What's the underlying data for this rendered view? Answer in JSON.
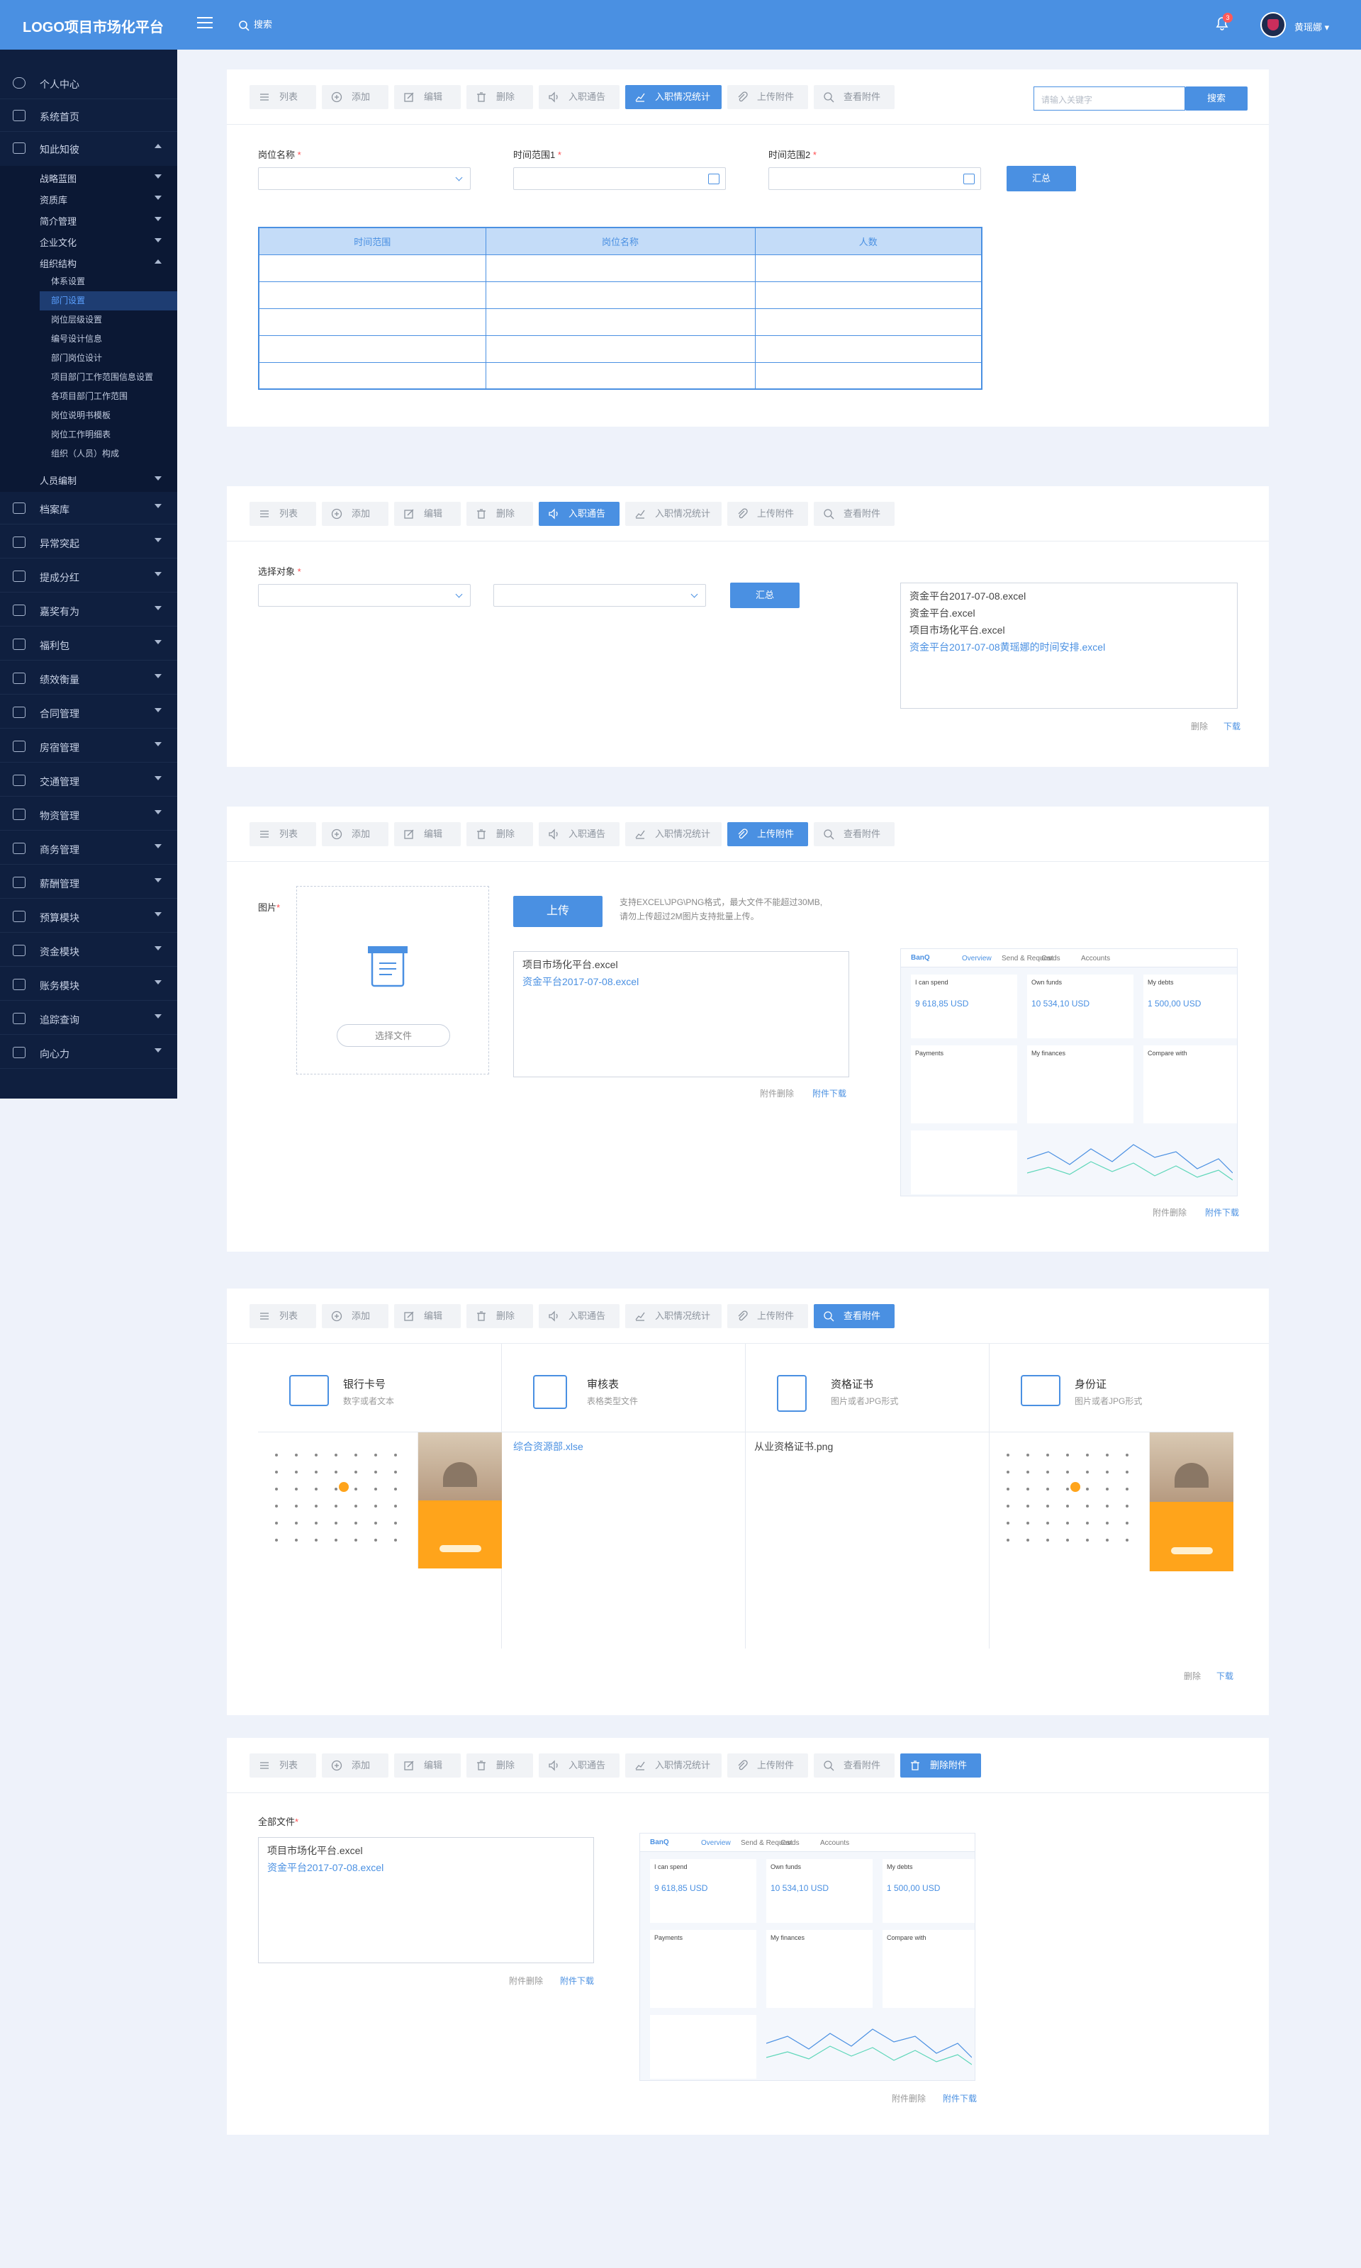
{
  "header": {
    "logo": "LOGO项目市场化平台",
    "search_label": "搜索",
    "notif_count": "3",
    "user_name": "黄瑶娜"
  },
  "sidebar": {
    "top_items": [
      {
        "label": "个人中心"
      },
      {
        "label": "系统首页"
      },
      {
        "label": "知此知彼"
      }
    ],
    "kb_sub": [
      "战略蓝图",
      "资质库",
      "简介管理",
      "企业文化",
      "组织结构"
    ],
    "org_sub": [
      "体系设置",
      "部门设置",
      "岗位层级设置",
      "编号设计信息",
      "部门岗位设计",
      "项目部门工作范围信息设置",
      "各项目部门工作范围",
      "岗位说明书模板",
      "岗位工作明细表",
      "组织（人员）构成"
    ],
    "people": "人员编制",
    "bottom_items": [
      "档案库",
      "异常突起",
      "提成分红",
      "嘉奖有为",
      "福利包",
      "绩效衡量",
      "合同管理",
      "房宿管理",
      "交通管理",
      "物资管理",
      "商务管理",
      "薪酬管理",
      "预算模块",
      "资金模块",
      "账务模块",
      "追踪查询",
      "向心力"
    ]
  },
  "toolbar": {
    "list": "列表",
    "add": "添加",
    "edit": "编辑",
    "delete": "删除",
    "notice": "入职通告",
    "stats": "入职情况统计",
    "upload": "上传附件",
    "view": "查看附件",
    "del_attach": "删除附件"
  },
  "section1": {
    "search_placeholder": "请输入关键字",
    "search_btn": "搜索",
    "pos_label": "岗位名称",
    "range1_label": "时间范围1",
    "range2_label": "时间范围2",
    "sum_btn": "汇总",
    "table_headers": [
      "时间范围",
      "岗位名称",
      "人数"
    ]
  },
  "section2": {
    "target_label": "选择对象",
    "sum_btn": "汇总",
    "files": [
      "资金平台2017-07-08.excel",
      "资金平台.excel",
      "项目市场化平台.excel"
    ],
    "file_link": "资金平台2017-07-08黄瑶娜的时间安排.excel",
    "delete": "删除",
    "download": "下载"
  },
  "section3": {
    "image_label": "图片",
    "choose_file": "选择文件",
    "upload_btn": "上传",
    "hint1": "支持EXCEL\\JPG\\PNG格式，最大文件不能超过30MB,",
    "hint2": "请勿上传超过2M图片支持批量上传。",
    "file1": "项目市场化平台.excel",
    "file2": "资金平台2017-07-08.excel",
    "attach_delete": "附件删除",
    "attach_download": "附件下载"
  },
  "section4": {
    "columns": [
      {
        "title": "银行卡号",
        "sub": "数字或者文本"
      },
      {
        "title": "审核表",
        "sub": "表格类型文件"
      },
      {
        "title": "资格证书",
        "sub": "图片或者JPG形式"
      },
      {
        "title": "身份证",
        "sub": "图片或者JPG形式"
      }
    ],
    "audit_file": "综合资源部.xlse",
    "cert_file": "从业资格证书.png",
    "delete": "删除",
    "download": "下载"
  },
  "section5": {
    "all_files_label": "全部文件",
    "file1": "项目市场化平台.excel",
    "file2": "资金平台2017-07-08.excel",
    "attach_delete": "附件删除",
    "attach_download": "附件下载"
  },
  "dash_mock": {
    "brand": "BanQ",
    "tabs": [
      "Overview",
      "Send & Request",
      "Cards",
      "Accounts"
    ],
    "stats": [
      {
        "t": "I can spend",
        "v": "9 618,85 USD"
      },
      {
        "t": "Own funds",
        "v": "10 534,10 USD"
      },
      {
        "t": "My debts",
        "v": "1 500,00 USD"
      }
    ],
    "panels": [
      "Payments",
      "My finances",
      "Compare with"
    ]
  },
  "colors": {
    "primary": "#4a90e2",
    "sidebar": "#0f1f3f",
    "required": "#ff4d4f"
  }
}
